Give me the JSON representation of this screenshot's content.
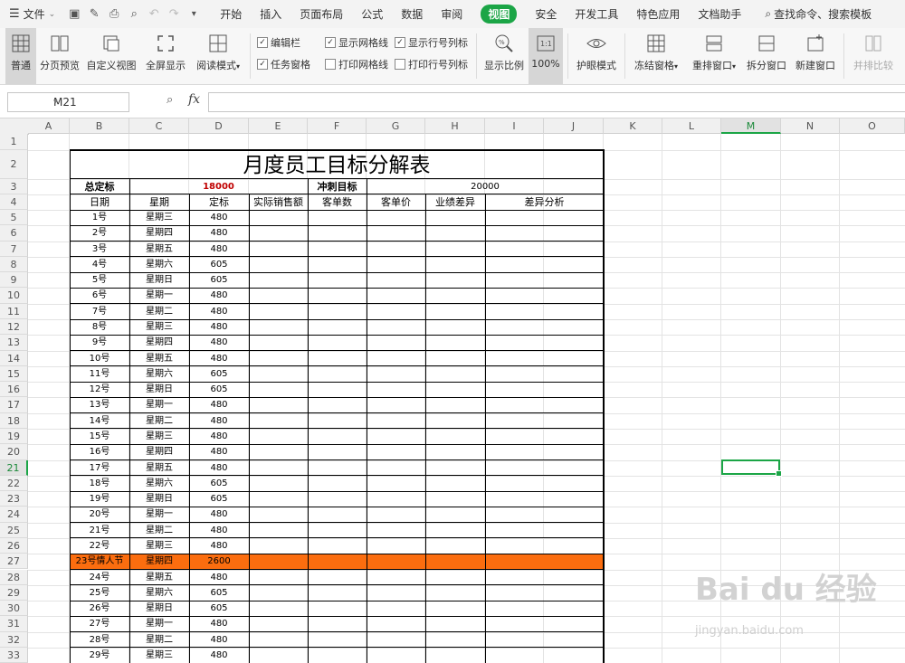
{
  "menu": {
    "file": "文件",
    "tabs": [
      "开始",
      "插入",
      "页面布局",
      "公式",
      "数据",
      "审阅",
      "视图",
      "安全",
      "开发工具",
      "特色应用",
      "文档助手"
    ],
    "active_tab": "视图",
    "search": "查找命令、搜索模板"
  },
  "ribbon": {
    "buttons": [
      "普通",
      "分页预览",
      "自定义视图",
      "全屏显示",
      "阅读模式",
      "显示比例",
      "100%",
      "护眼模式",
      "冻结窗格",
      "重排窗口",
      "拆分窗口",
      "新建窗口",
      "并排比较"
    ],
    "checkboxes": [
      {
        "label": "编辑栏",
        "checked": true
      },
      {
        "label": "任务窗格",
        "checked": true
      },
      {
        "label": "显示网格线",
        "checked": true
      },
      {
        "label": "打印网格线",
        "checked": false
      },
      {
        "label": "显示行号列标",
        "checked": true
      },
      {
        "label": "打印行号列标",
        "checked": false
      }
    ]
  },
  "formula_bar": {
    "name_box": "M21",
    "fx": "fx",
    "value": ""
  },
  "grid": {
    "columns": [
      "A",
      "B",
      "C",
      "D",
      "E",
      "F",
      "G",
      "H",
      "I",
      "J",
      "K",
      "L",
      "M",
      "N",
      "O"
    ],
    "rows": [
      "1",
      "2",
      "3",
      "4",
      "5",
      "6",
      "7",
      "8",
      "9",
      "10",
      "11",
      "12",
      "13",
      "14",
      "15",
      "16",
      "17",
      "18",
      "19",
      "20",
      "21",
      "22",
      "23",
      "24",
      "25",
      "26",
      "27",
      "28",
      "29",
      "30",
      "31",
      "32",
      "33"
    ],
    "selected_column": "M",
    "selected_row": "21"
  },
  "sheet": {
    "title": "月度员工目标分解表",
    "total_label": "总定标",
    "total_value": "18000",
    "stretch_label": "冲刺目标",
    "stretch_value": "20000",
    "headers": [
      "日期",
      "星期",
      "定标",
      "实际销售额",
      "客单数",
      "客单价",
      "业绩差异",
      "差异分析"
    ],
    "highlight_color": "#fb6d0f",
    "total_value_color": "#c00000",
    "rows": [
      [
        "1号",
        "星期三",
        "480"
      ],
      [
        "2号",
        "星期四",
        "480"
      ],
      [
        "3号",
        "星期五",
        "480"
      ],
      [
        "4号",
        "星期六",
        "605"
      ],
      [
        "5号",
        "星期日",
        "605"
      ],
      [
        "6号",
        "星期一",
        "480"
      ],
      [
        "7号",
        "星期二",
        "480"
      ],
      [
        "8号",
        "星期三",
        "480"
      ],
      [
        "9号",
        "星期四",
        "480"
      ],
      [
        "10号",
        "星期五",
        "480"
      ],
      [
        "11号",
        "星期六",
        "605"
      ],
      [
        "12号",
        "星期日",
        "605"
      ],
      [
        "13号",
        "星期一",
        "480"
      ],
      [
        "14号",
        "星期二",
        "480"
      ],
      [
        "15号",
        "星期三",
        "480"
      ],
      [
        "16号",
        "星期四",
        "480"
      ],
      [
        "17号",
        "星期五",
        "480"
      ],
      [
        "18号",
        "星期六",
        "605"
      ],
      [
        "19号",
        "星期日",
        "605"
      ],
      [
        "20号",
        "星期一",
        "480"
      ],
      [
        "21号",
        "星期二",
        "480"
      ],
      [
        "22号",
        "星期三",
        "480"
      ],
      [
        "23号情人节",
        "星期四",
        "2600"
      ],
      [
        "24号",
        "星期五",
        "480"
      ],
      [
        "25号",
        "星期六",
        "605"
      ],
      [
        "26号",
        "星期日",
        "605"
      ],
      [
        "27号",
        "星期一",
        "480"
      ],
      [
        "28号",
        "星期二",
        "480"
      ],
      [
        "29号",
        "星期三",
        "480"
      ]
    ]
  },
  "watermark": {
    "brand": "Bai du 经验",
    "url": "jingyan.baidu.com"
  }
}
